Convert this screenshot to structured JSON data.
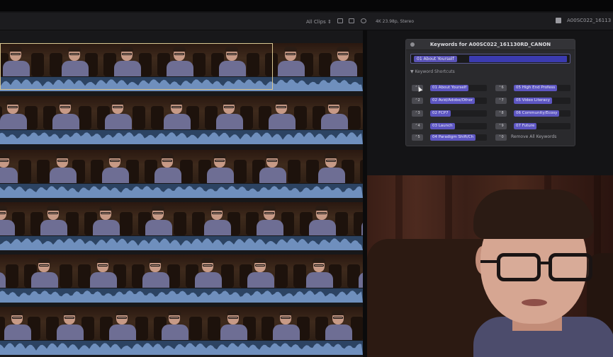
{
  "toolbar": {
    "clip_filter": "All Clips ⇕",
    "format_info": "4K 23.98p, Stereo",
    "clip_name": "A00SC022_16113"
  },
  "keywords_panel": {
    "title": "Keywords for A00SC022_161130RD_CANON",
    "field_token": "01 About Yourself",
    "shortcuts_header": "▼ Keyword Shortcuts",
    "shortcuts": [
      {
        "key": "⌃1",
        "label": "01 About Yourself"
      },
      {
        "key": "⌃2",
        "label": "02 Avid/Adobe/Other"
      },
      {
        "key": "⌃3",
        "label": "02 FCP7"
      },
      {
        "key": "⌃4",
        "label": "03 Launch"
      },
      {
        "key": "⌃5",
        "label": "04 Paradigm Shift/Ch"
      },
      {
        "key": "⌃6",
        "label": "05 High End Profess"
      },
      {
        "key": "⌃7",
        "label": "05 Video Literacy"
      },
      {
        "key": "⌃8",
        "label": "06 Community/Ecosy"
      },
      {
        "key": "⌃9",
        "label": "07 Future"
      }
    ],
    "remove_all": "Remove All Keywords"
  },
  "colors": {
    "keyword_accent": "#5d56c2",
    "selection_border": "#d9c792",
    "waveform": "#2c4362"
  }
}
